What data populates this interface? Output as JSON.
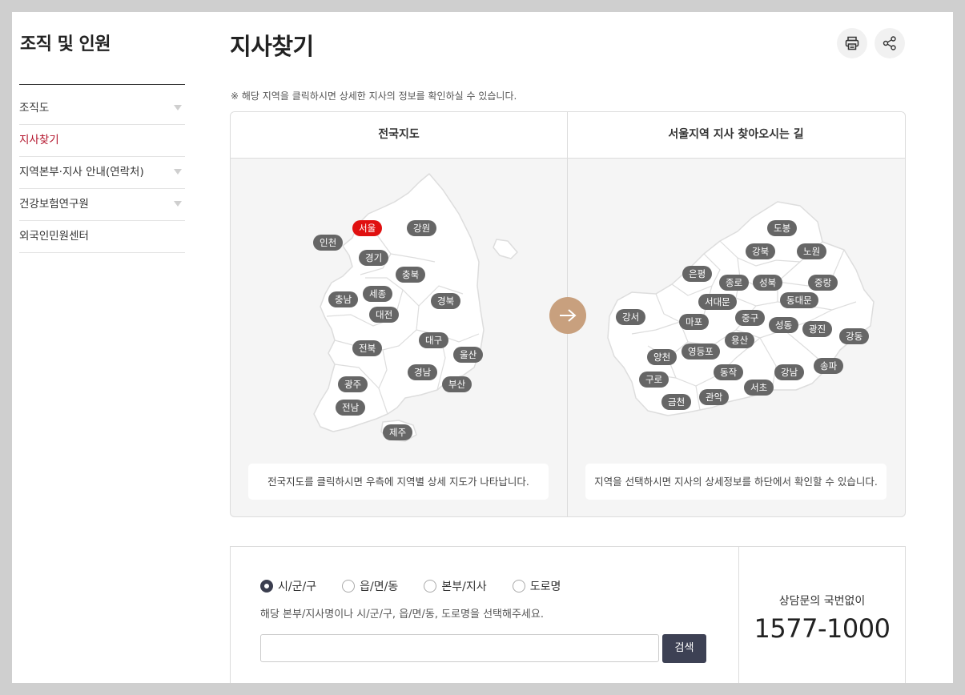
{
  "sidebar": {
    "title": "조직 및 인원",
    "items": [
      {
        "label": "조직도"
      },
      {
        "label": "지사찾기"
      },
      {
        "label": "지역본부·지사 안내(연락처)"
      },
      {
        "label": "건강보험연구원"
      },
      {
        "label": "외국인민원센터"
      }
    ]
  },
  "header": {
    "title": "지사찾기",
    "icons": [
      "printer-icon",
      "share-icon"
    ]
  },
  "notice": "※ 해당 지역을 클릭하시면 상세한 지사의 정보를 확인하실 수 있습니다.",
  "map": {
    "left_title": "전국지도",
    "right_title": "서울지역 지사 찾아오시는 길",
    "national_regions": [
      "서울",
      "강원",
      "인천",
      "경기",
      "충북",
      "충남",
      "세종",
      "경북",
      "대전",
      "대구",
      "전북",
      "울산",
      "경남",
      "광주",
      "부산",
      "전남",
      "제주"
    ],
    "seoul_regions": [
      "도봉",
      "강북",
      "노원",
      "은평",
      "종로",
      "성북",
      "중랑",
      "서대문",
      "동대문",
      "강서",
      "마포",
      "중구",
      "성동",
      "광진",
      "강동",
      "용산",
      "양천",
      "영등포",
      "구로",
      "동작",
      "강남",
      "송파",
      "서초",
      "금천",
      "관악"
    ],
    "selected_region": "서울",
    "left_caption": "전국지도를 클릭하시면 우측에 지역별 상세 지도가 나타납니다.",
    "right_caption": "지역을 선택하시면 지사의 상세정보를 하단에서 확인할 수 있습니다.",
    "colors": {
      "selected": "#e01010",
      "chip": "#666666",
      "arrow": "#c8a07e"
    }
  },
  "search": {
    "options": [
      {
        "label": "시/군/구",
        "selected": true
      },
      {
        "label": "읍/면/동",
        "selected": false
      },
      {
        "label": "본부/지사",
        "selected": false
      },
      {
        "label": "도로명",
        "selected": false
      }
    ],
    "hint": "해당 본부/지사명이나 시/군/구, 읍/면/동, 도로명을 선택해주세요.",
    "input_value": "",
    "button": "검색"
  },
  "call": {
    "label": "상담문의 국번없이",
    "number": "1577-1000"
  }
}
